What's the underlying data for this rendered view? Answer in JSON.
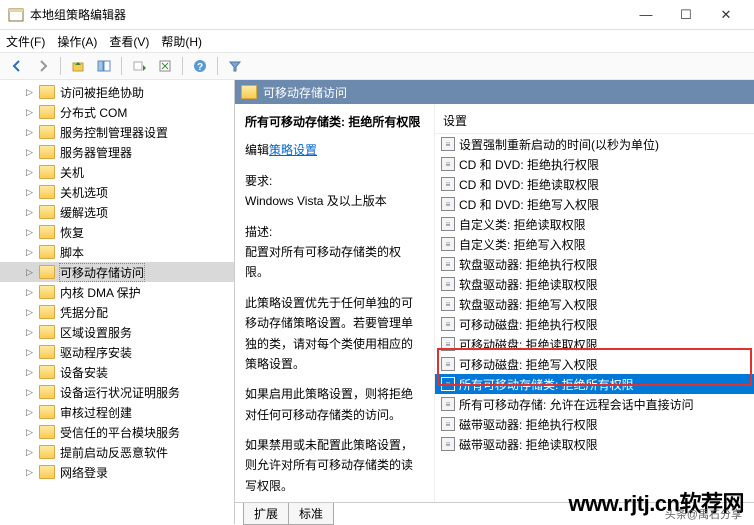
{
  "window": {
    "title": "本地组策略编辑器",
    "controls": {
      "min": "—",
      "max": "☐",
      "close": "✕"
    }
  },
  "menubar": [
    "文件(F)",
    "操作(A)",
    "查看(V)",
    "帮助(H)"
  ],
  "tree": {
    "items": [
      {
        "label": "访问被拒绝协助",
        "sel": false
      },
      {
        "label": "分布式 COM",
        "sel": false
      },
      {
        "label": "服务控制管理器设置",
        "sel": false
      },
      {
        "label": "服务器管理器",
        "sel": false
      },
      {
        "label": "关机",
        "sel": false
      },
      {
        "label": "关机选项",
        "sel": false
      },
      {
        "label": "缓解选项",
        "sel": false
      },
      {
        "label": "恢复",
        "sel": false
      },
      {
        "label": "脚本",
        "sel": false
      },
      {
        "label": "可移动存储访问",
        "sel": true
      },
      {
        "label": "内核 DMA 保护",
        "sel": false
      },
      {
        "label": "凭据分配",
        "sel": false
      },
      {
        "label": "区域设置服务",
        "sel": false
      },
      {
        "label": "驱动程序安装",
        "sel": false
      },
      {
        "label": "设备安装",
        "sel": false
      },
      {
        "label": "设备运行状况证明服务",
        "sel": false
      },
      {
        "label": "审核过程创建",
        "sel": false
      },
      {
        "label": "受信任的平台模块服务",
        "sel": false
      },
      {
        "label": "提前启动反恶意软件",
        "sel": false
      },
      {
        "label": "网络登录",
        "sel": false
      }
    ]
  },
  "path_header": "可移动存储访问",
  "detail": {
    "policy_title": "所有可移动存储类: 拒绝所有权限",
    "edit_prefix": "编辑",
    "edit_link": "策略设置",
    "req_label": "要求:",
    "req_text": "Windows Vista 及以上版本",
    "desc_label": "描述:",
    "desc_text": "配置对所有可移动存储类的权限。",
    "para1": "此策略设置优先于任何单独的可移动存储策略设置。若要管理单独的类，请对每个类使用相应的策略设置。",
    "para2": "如果启用此策略设置，则将拒绝对任何可移动存储类的访问。",
    "para3": "如果禁用或未配置此策略设置，则允许对所有可移动存储类的读写权限。"
  },
  "list": {
    "header": "设置",
    "items": [
      {
        "label": "设置强制重新启动的时间(以秒为单位)",
        "sel": false
      },
      {
        "label": "CD 和 DVD: 拒绝执行权限",
        "sel": false
      },
      {
        "label": "CD 和 DVD: 拒绝读取权限",
        "sel": false
      },
      {
        "label": "CD 和 DVD: 拒绝写入权限",
        "sel": false
      },
      {
        "label": "自定义类: 拒绝读取权限",
        "sel": false
      },
      {
        "label": "自定义类: 拒绝写入权限",
        "sel": false
      },
      {
        "label": "软盘驱动器: 拒绝执行权限",
        "sel": false
      },
      {
        "label": "软盘驱动器: 拒绝读取权限",
        "sel": false
      },
      {
        "label": "软盘驱动器: 拒绝写入权限",
        "sel": false
      },
      {
        "label": "可移动磁盘: 拒绝执行权限",
        "sel": false
      },
      {
        "label": "可移动磁盘: 拒绝读取权限",
        "sel": false
      },
      {
        "label": "可移动磁盘: 拒绝写入权限",
        "sel": false
      },
      {
        "label": "所有可移动存储类: 拒绝所有权限",
        "sel": true
      },
      {
        "label": "所有可移动存储: 允许在远程会话中直接访问",
        "sel": false
      },
      {
        "label": "磁带驱动器: 拒绝执行权限",
        "sel": false
      },
      {
        "label": "磁带驱动器: 拒绝读取权限",
        "sel": false
      }
    ]
  },
  "tabs": {
    "extended": "扩展",
    "standard": "标准"
  },
  "watermark": "www.rjtj.cn软荐网",
  "attribution": "头条@禹石分享"
}
